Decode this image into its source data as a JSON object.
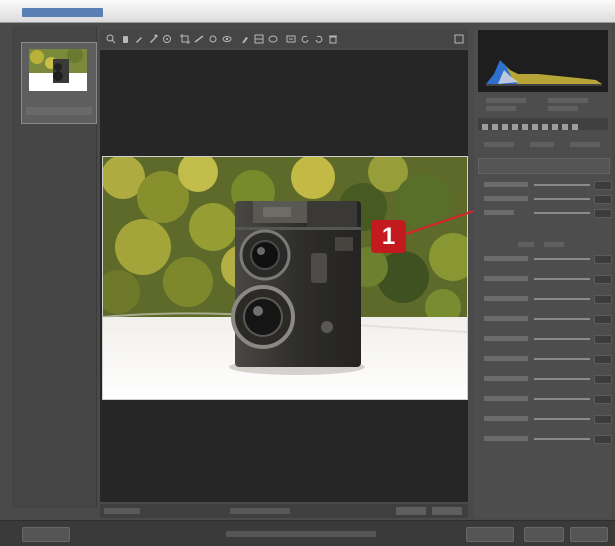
{
  "app": {
    "title": "",
    "titlebar_color": "#f0f0f0"
  },
  "filmstrip": {
    "heading": "",
    "thumbnail": "camera-photo-thumbnail"
  },
  "toolbar": {
    "icons": [
      "zoom-icon",
      "hand-icon",
      "white-balance-icon",
      "color-sampler-icon",
      "target-adjust-icon",
      "crop-icon",
      "straighten-icon",
      "spot-removal-icon",
      "red-eye-icon",
      "adjustment-brush-icon",
      "graduated-filter-icon",
      "radial-filter-icon",
      "preferences-icon",
      "rotate-left-icon",
      "rotate-right-icon",
      "trash-icon"
    ]
  },
  "preview": {
    "image": "twin-lens-reflex-camera-on-white-surface-with-foliage-background"
  },
  "callout": {
    "number": "1",
    "color": "#c21a1f"
  },
  "right_panel": {
    "tab_icons": [
      "basic-icon",
      "tone-curve-icon",
      "detail-icon",
      "hsl-icon",
      "split-toning-icon",
      "lens-icon",
      "effects-icon",
      "camera-calibration-icon",
      "presets-icon",
      "snapshots-icon"
    ]
  },
  "colors": {
    "ui_dark": "#4a4a4a",
    "preview_bg": "#262626",
    "accent_red": "#c21a1f"
  }
}
